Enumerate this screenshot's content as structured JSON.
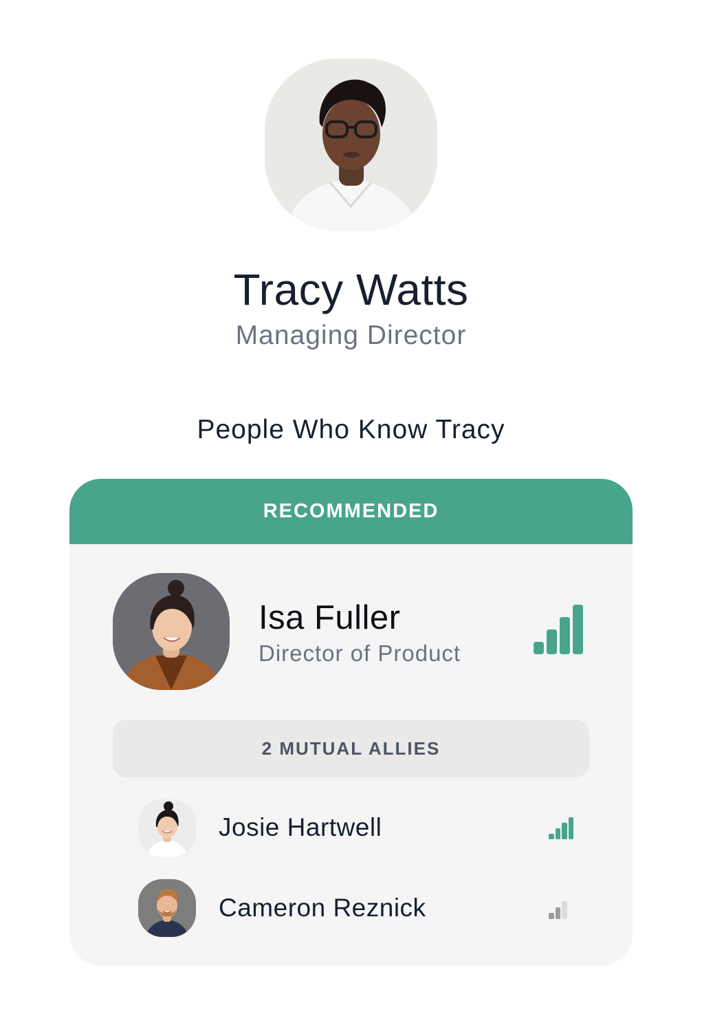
{
  "profile": {
    "name": "Tracy Watts",
    "title": "Managing Director",
    "avatar": "avatar-tracy-watts"
  },
  "section_heading": "People Who Know Tracy",
  "card": {
    "header_label": "RECOMMENDED",
    "recommended": {
      "name": "Isa Fuller",
      "title": "Director of Product",
      "avatar": "avatar-isa-fuller",
      "strength": 4,
      "strength_max": 4,
      "strength_color": "#48a58c"
    },
    "mutual_label": "2 MUTUAL ALLIES",
    "allies": [
      {
        "name": "Josie Hartwell",
        "avatar": "avatar-josie-hartwell",
        "strength": 4,
        "strength_max": 4,
        "strength_color": "#48a58c"
      },
      {
        "name": "Cameron Reznick",
        "avatar": "avatar-cameron-reznick",
        "strength": 2,
        "strength_max": 3,
        "strength_color": "#9a9a9a"
      }
    ]
  },
  "colors": {
    "accent": "#48a58c",
    "card_bg": "#f5f5f5",
    "pill_bg": "#e9e9e9"
  }
}
